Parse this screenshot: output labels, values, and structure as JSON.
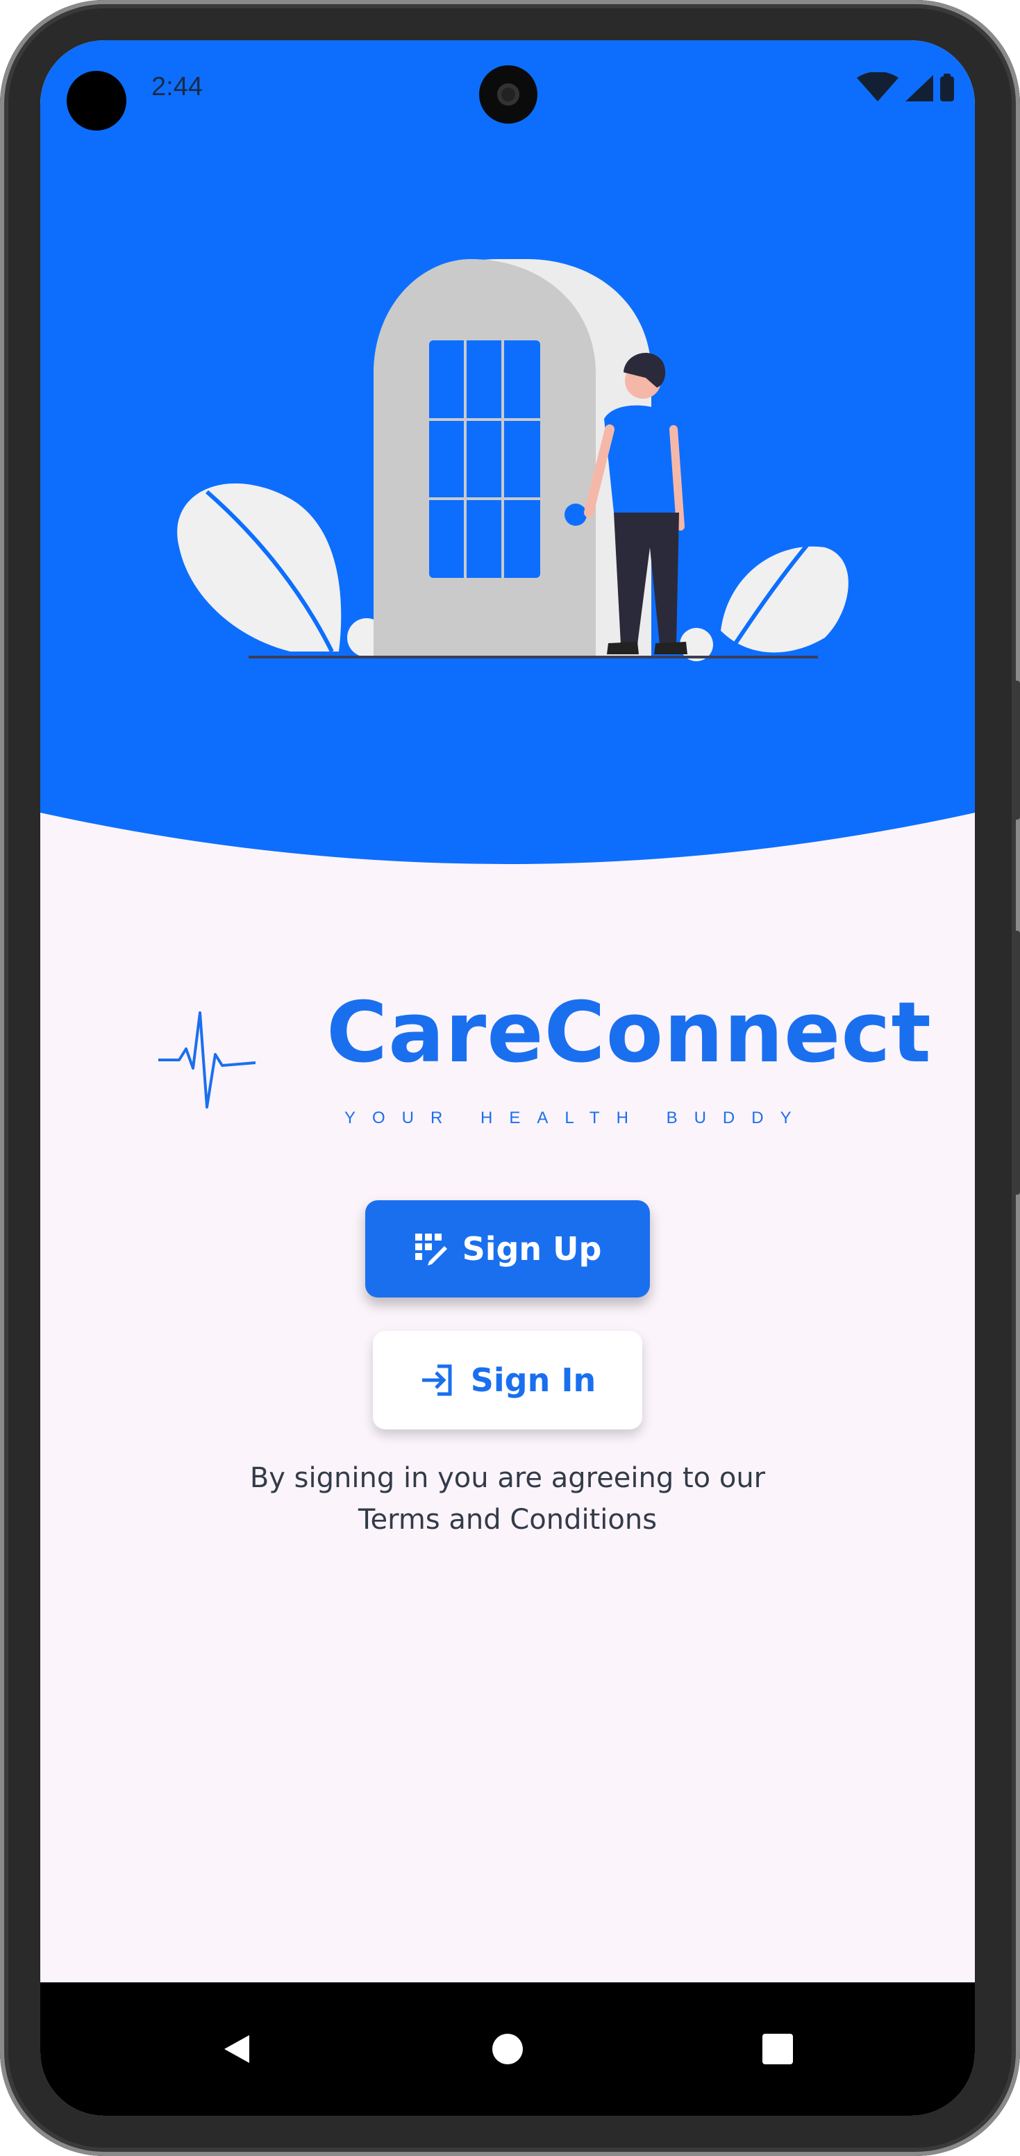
{
  "status_bar": {
    "time": "2:44"
  },
  "brand": {
    "name": "CareConnect",
    "tagline": "YOUR HEALTH BUDDY"
  },
  "buttons": {
    "sign_up": "Sign Up",
    "sign_in": "Sign In"
  },
  "terms": {
    "line1": "By signing in you are agreeing to our",
    "line2": "Terms and Conditions"
  },
  "colors": {
    "accent": "#1A6FEF",
    "background": "#FBF4FB"
  },
  "icons": {
    "sign_up": "edit-grid-icon",
    "sign_in": "login-arrow-icon",
    "logo": "heartbeat-icon",
    "nav_back": "back-triangle-icon",
    "nav_home": "home-circle-icon",
    "nav_recents": "recents-square-icon"
  }
}
